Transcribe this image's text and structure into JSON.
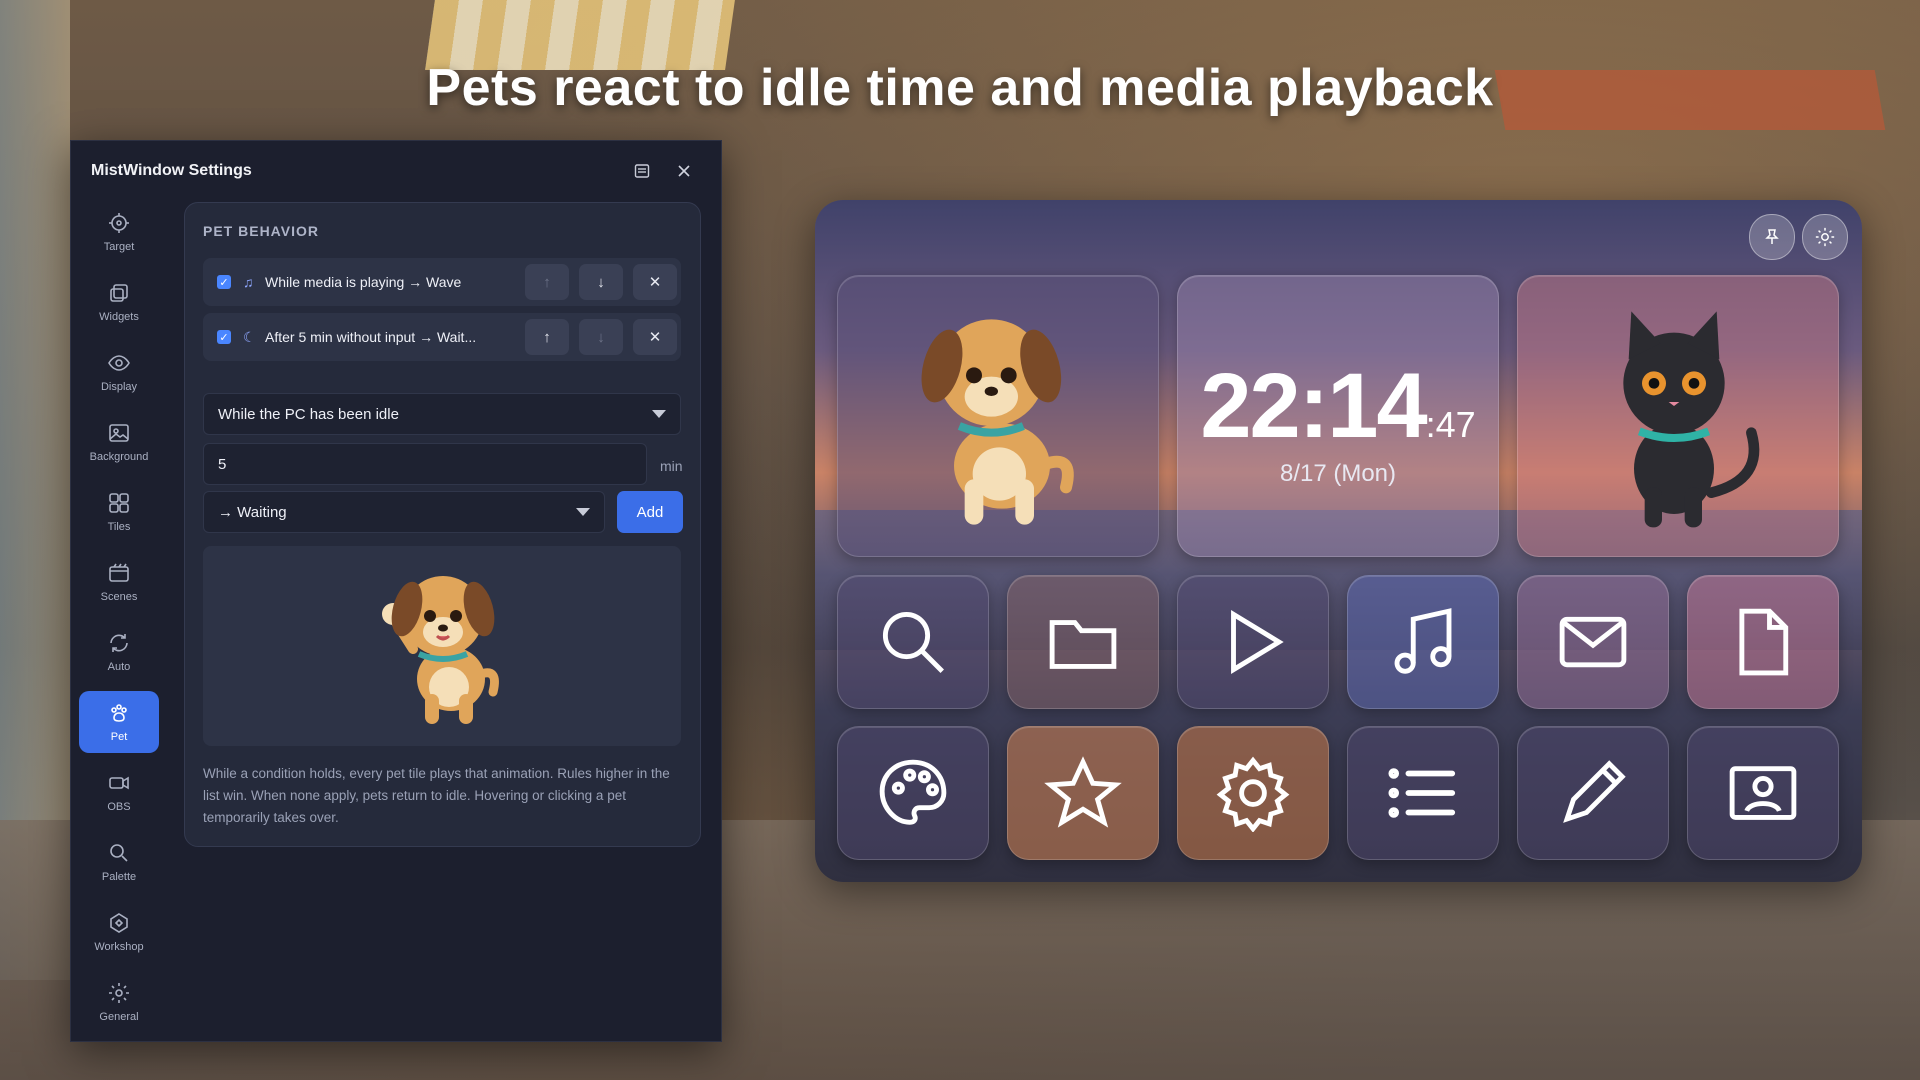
{
  "headline": "Pets react to idle time and media playback",
  "window": {
    "title": "MistWindow Settings"
  },
  "nav": [
    {
      "label": "Target",
      "icon": "target-icon"
    },
    {
      "label": "Widgets",
      "icon": "widgets-icon"
    },
    {
      "label": "Display",
      "icon": "eye-icon"
    },
    {
      "label": "Background",
      "icon": "image-icon"
    },
    {
      "label": "Tiles",
      "icon": "grid-icon"
    },
    {
      "label": "Scenes",
      "icon": "scenes-icon"
    },
    {
      "label": "Auto",
      "icon": "refresh-icon"
    },
    {
      "label": "Pet",
      "icon": "paw-icon",
      "active": true
    },
    {
      "label": "OBS",
      "icon": "camera-icon"
    },
    {
      "label": "Palette",
      "icon": "search-icon"
    },
    {
      "label": "Workshop",
      "icon": "workshop-icon"
    },
    {
      "label": "General",
      "icon": "gear-icon"
    }
  ],
  "pet_behavior": {
    "heading": "PET BEHAVIOR",
    "rules": [
      {
        "checked": true,
        "icon": "music-note-icon",
        "label": "While media is playing → Wave",
        "up_enabled": false,
        "down_enabled": true
      },
      {
        "checked": true,
        "icon": "sleep-icon",
        "label": "After 5 min without input → Wait...",
        "up_enabled": true,
        "down_enabled": false
      }
    ],
    "condition_select": "While the PC has been idle",
    "minutes_value": "5",
    "minutes_unit": "min",
    "animation_select": "→ Waiting",
    "add_label": "Add",
    "help_text": "While a condition holds, every pet tile plays that animation. Rules higher in the list win. When none apply, pets return to idle. Hovering or clicking a pet temporarily takes over."
  },
  "board": {
    "clock": {
      "time": "22:14",
      "seconds": ":47",
      "date": "8/17 (Mon)"
    },
    "row1_icons": [
      "search-icon",
      "folder-icon",
      "play-icon",
      "music-icon",
      "mail-icon",
      "document-icon"
    ],
    "row2_icons": [
      "palette-icon",
      "star-icon",
      "gear-icon",
      "list-icon",
      "pencil-icon",
      "id-card-icon"
    ]
  },
  "colors": {
    "accent": "#3b6ee8",
    "window_bg": "#1c1f2e",
    "panel_bg": "#252a3b"
  }
}
